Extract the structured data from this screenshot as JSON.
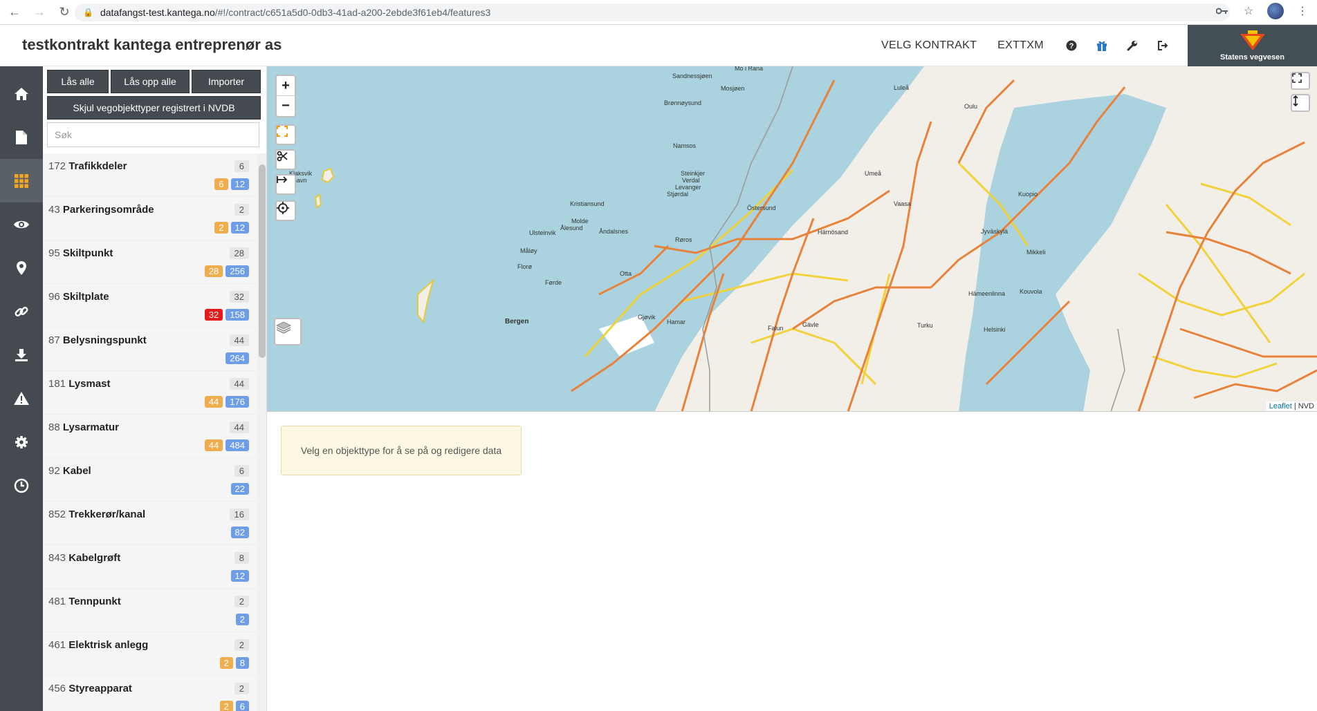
{
  "browser": {
    "url_host": "datafangst-test.kantega.no",
    "url_path": "/#!/contract/c651a5d0-0db3-41ad-a200-2ebde3f61eb4/features3"
  },
  "header": {
    "title": "testkontrakt kantega entreprenør as",
    "nav": [
      "VELG KONTRAKT",
      "EXTTXM"
    ],
    "logo_text": "Statens vegvesen",
    "brand_color": "#444f55"
  },
  "rail": {
    "items": [
      "home-icon",
      "document-icon",
      "grid-icon",
      "eye-icon",
      "map-marker-icon",
      "link-icon",
      "download-icon",
      "warning-icon",
      "gear-icon",
      "history-icon"
    ],
    "active": "grid-icon"
  },
  "panel": {
    "lock_all": "Lås alle",
    "unlock_all": "Lås opp alle",
    "import": "Importer",
    "hide_nvdb": "Skjul vegobjekttyper registrert i NVDB",
    "search_placeholder": "Søk",
    "items": [
      {
        "id": "172",
        "name": "Trafikkdeler",
        "count": "6",
        "badges": [
          {
            "v": "6",
            "c": "orange"
          },
          {
            "v": "12",
            "c": "blue"
          }
        ]
      },
      {
        "id": "43",
        "name": "Parkeringsområde",
        "count": "2",
        "badges": [
          {
            "v": "2",
            "c": "orange"
          },
          {
            "v": "12",
            "c": "blue"
          }
        ]
      },
      {
        "id": "95",
        "name": "Skiltpunkt",
        "count": "28",
        "badges": [
          {
            "v": "28",
            "c": "orange"
          },
          {
            "v": "256",
            "c": "blue"
          }
        ]
      },
      {
        "id": "96",
        "name": "Skiltplate",
        "count": "32",
        "badges": [
          {
            "v": "32",
            "c": "red"
          },
          {
            "v": "158",
            "c": "blue"
          }
        ]
      },
      {
        "id": "87",
        "name": "Belysningspunkt",
        "count": "44",
        "badges": [
          {
            "v": "264",
            "c": "blue"
          }
        ]
      },
      {
        "id": "181",
        "name": "Lysmast",
        "count": "44",
        "badges": [
          {
            "v": "44",
            "c": "orange"
          },
          {
            "v": "176",
            "c": "blue"
          }
        ]
      },
      {
        "id": "88",
        "name": "Lysarmatur",
        "count": "44",
        "badges": [
          {
            "v": "44",
            "c": "orange"
          },
          {
            "v": "484",
            "c": "blue"
          }
        ]
      },
      {
        "id": "92",
        "name": "Kabel",
        "count": "6",
        "badges": [
          {
            "v": "22",
            "c": "blue"
          }
        ]
      },
      {
        "id": "852",
        "name": "Trekkerør/kanal",
        "count": "16",
        "badges": [
          {
            "v": "82",
            "c": "blue"
          }
        ]
      },
      {
        "id": "843",
        "name": "Kabelgrøft",
        "count": "8",
        "badges": [
          {
            "v": "12",
            "c": "blue"
          }
        ]
      },
      {
        "id": "481",
        "name": "Tennpunkt",
        "count": "2",
        "badges": [
          {
            "v": "2",
            "c": "blue"
          }
        ]
      },
      {
        "id": "461",
        "name": "Elektrisk anlegg",
        "count": "2",
        "badges": [
          {
            "v": "2",
            "c": "orange"
          },
          {
            "v": "8",
            "c": "blue"
          }
        ]
      },
      {
        "id": "456",
        "name": "Styreapparat",
        "count": "2",
        "badges": [
          {
            "v": "2",
            "c": "orange"
          },
          {
            "v": "6",
            "c": "blue"
          }
        ]
      }
    ]
  },
  "map": {
    "zoom_in": "+",
    "zoom_out": "−",
    "attribution_link": "Leaflet",
    "attribution_rest": " | NVD",
    "labels": [
      "Sandnessjøen",
      "Mo i Rana",
      "Mosjøen",
      "Brønnøysund",
      "Luleå",
      "Oulu",
      "Namsos",
      "Klaksvik",
      "Tórshavn",
      "Steinkjer",
      "Verdal",
      "Levanger",
      "Umeå",
      "Stjørdal",
      "Kuopio",
      "Kristiansund",
      "Östersund",
      "Vaasa",
      "Molde",
      "Ålesund",
      "Åndalsnes",
      "Ulsteinvik",
      "Røros",
      "Härnösand",
      "Jyväskylä",
      "Måløy",
      "Mikkeli",
      "Florø",
      "Otta",
      "Førde",
      "Hämeenlinna",
      "Kouvola",
      "Gjøvik",
      "Hamar",
      "Bergen",
      "Gävle",
      "Falun",
      "Turku",
      "Helsinki"
    ]
  },
  "info": {
    "message": "Velg en objekttype for å se på og redigere data"
  }
}
